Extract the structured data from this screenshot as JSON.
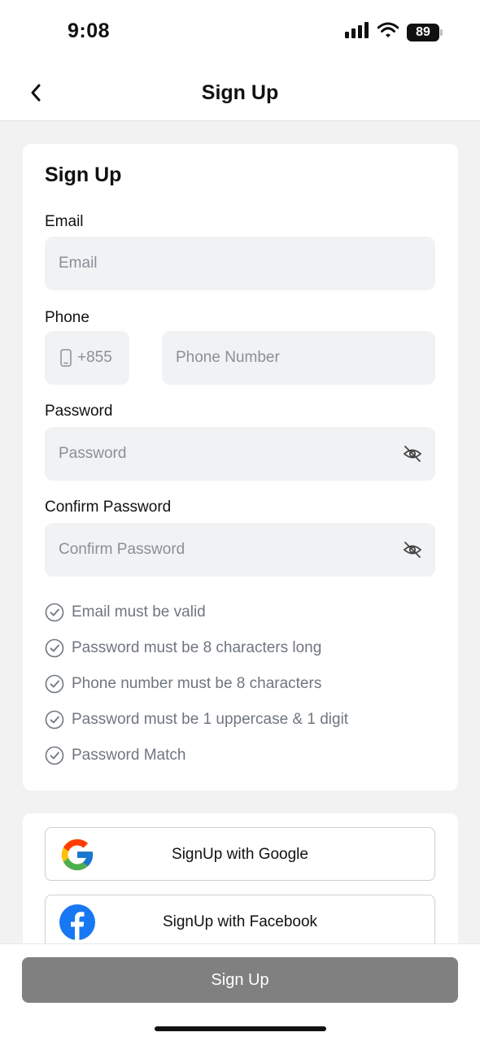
{
  "status_bar": {
    "time": "9:08",
    "battery": "89"
  },
  "nav": {
    "title": "Sign Up"
  },
  "form": {
    "title": "Sign Up",
    "email": {
      "label": "Email",
      "placeholder": "Email"
    },
    "phone": {
      "label": "Phone",
      "country_code": "+855",
      "placeholder": "Phone Number"
    },
    "password": {
      "label": "Password",
      "placeholder": "Password"
    },
    "confirm_password": {
      "label": "Confirm Password",
      "placeholder": "Confirm Password"
    },
    "rules": [
      "Email must be valid",
      "Password must be 8 characters long",
      "Phone number must be 8 characters",
      "Password must be 1 uppercase & 1 digit",
      "Password Match"
    ]
  },
  "social": {
    "google_label": "SignUp with Google",
    "facebook_label": "SignUp with Facebook"
  },
  "footer": {
    "signup_label": "Sign Up"
  },
  "colors": {
    "primary_button_disabled": "#808080",
    "input_bg": "#f1f2f4",
    "facebook_blue": "#1877F2"
  }
}
